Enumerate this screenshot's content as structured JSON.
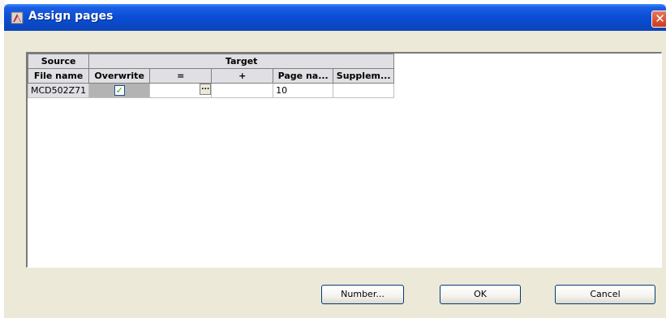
{
  "window": {
    "title": "Assign pages",
    "close_label": "✕"
  },
  "grid": {
    "group_headers": {
      "source": "Source",
      "target": "Target"
    },
    "columns": [
      "File name",
      "Overwrite",
      "=",
      "+",
      "Page na...",
      "Supplem..."
    ],
    "rows": [
      {
        "file_name": "MCD502Z71",
        "overwrite_checked": true,
        "eq_value": "",
        "plus_value": "",
        "page_name": "10",
        "supplement": ""
      }
    ],
    "ellipsis_label": "..."
  },
  "buttons": {
    "number": "Number...",
    "ok": "OK",
    "cancel": "Cancel"
  },
  "colors": {
    "titlebar": "#0b4fd8",
    "dialog_bg": "#ece9d8",
    "close_button": "#cc3a1c"
  }
}
